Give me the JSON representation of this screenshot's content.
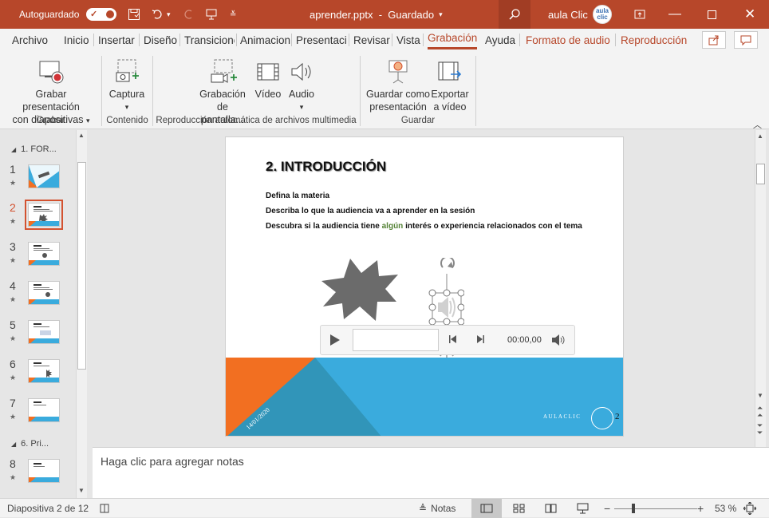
{
  "titlebar": {
    "autosave_label": "Autoguardado",
    "autosave_state": "Sí",
    "file_title": "aprender.pptx",
    "save_status": "Guardado",
    "user_name": "aula Clic",
    "avatar_text": "aula\nclic"
  },
  "tabs": [
    "Archivo",
    "Inicio",
    "Insertar",
    "Diseño",
    "Transiciones",
    "Animaciones",
    "Presentación",
    "Revisar",
    "Vista",
    "Grabación",
    "Ayuda",
    "Formato de audio",
    "Reproducción"
  ],
  "ribbon": {
    "grabar_line1": "Grabar presentación",
    "grabar_line2": "con diapositivas",
    "captura": "Captura",
    "grab_pantalla_line1": "Grabación",
    "grab_pantalla_line2": "de pantalla...",
    "video": "Vídeo",
    "audio": "Audio",
    "guardar_line1": "Guardar como",
    "guardar_line2": "presentación",
    "exportar_line1": "Exportar",
    "exportar_line2": "a vídeo",
    "group_grabar": "Grabar",
    "group_contenido": "Contenido",
    "group_reproduccion": "Reproducción automática de archivos multimedia",
    "group_guardar": "Guardar"
  },
  "sections": [
    {
      "label": "1. FOR..."
    },
    {
      "label": "6. Pri..."
    }
  ],
  "slides": [
    {
      "num": "1"
    },
    {
      "num": "2"
    },
    {
      "num": "3"
    },
    {
      "num": "4"
    },
    {
      "num": "5"
    },
    {
      "num": "6"
    },
    {
      "num": "7"
    },
    {
      "num": "8"
    }
  ],
  "slide": {
    "title": "2. INTRODUCCIÓN",
    "line1": "Defina la materia",
    "line2": "Describa lo que la audiencia va a aprender en la sesión",
    "line3_pre": "Descubra si la audiencia tiene ",
    "line3_hl": "algún",
    "line3_post": " interés o experiencia relacionados con el tema",
    "date": "14/01/2020",
    "footer": "AULACLIC",
    "page_num": "2",
    "player_time": "00:00,00"
  },
  "notes_placeholder": "Haga clic para agregar notas",
  "status": {
    "slide_info": "Diapositiva 2 de 12",
    "notes_label": "Notas",
    "zoom": "53 %"
  },
  "colors": {
    "accent": "#b7472a",
    "selected_thumb": "#d35230",
    "slide_blue": "#3aabdd",
    "slide_orange": "#f26f21"
  }
}
